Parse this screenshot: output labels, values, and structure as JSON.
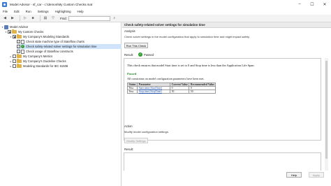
{
  "window": {
    "title": "Model Advisor - sf_car - c:\\demos\\My Custom Checks.mat",
    "minimize": "–",
    "maximize": "☐",
    "close": "✕"
  },
  "menu": [
    "File",
    "Edit",
    "Run",
    "Settings",
    "Highlighting",
    "Help"
  ],
  "toolbar": {
    "find_label": "Find:",
    "find_value": ""
  },
  "tree": {
    "root": "Model Advisor",
    "custom": "My Custom Checks",
    "modeling_standards": "My Company's Modeling Standards",
    "check1": "Check state machine type of Stateflow charts",
    "check2": "Check safety-related solver settings for simulation time",
    "check3": "Check usage of Stateflow constructs",
    "metrics": "My Company's Metrics",
    "guideline": "My Company's Guideline Checks",
    "iec": "Modeling Standards for IEC 61508"
  },
  "right": {
    "header": "Check safety-related solver settings for simulation time",
    "analysis_label": "Analysis",
    "analysis_desc": "Check solver settings in the model configuration that apply to simulation time and might impact safety.",
    "run_button": "Run This Check",
    "result_label": "Result:",
    "result_status": "Passed",
    "report": {
      "intro": "This check ensures that model Start time is set to 0 and Stop time is less than the Application Life Span.",
      "passed": "Passed",
      "all_constraints": "All constraints on model configuration parameters have been met.",
      "table": {
        "headers": [
          "Status",
          "Parameter",
          "Current Value",
          "Recommended Value"
        ],
        "rows": [
          [
            "Pass",
            "Start time (StartTime)",
            "0",
            "0"
          ],
          [
            "Pass",
            "Stop time (StopTime)",
            "50",
            "50"
          ]
        ]
      }
    },
    "action_label": "Action",
    "action_desc": "Modify model configuration settings.",
    "modify_button": "Modify Settings",
    "result2_label": "Result:",
    "help_button": "Help",
    "apply_button": "Apply"
  }
}
